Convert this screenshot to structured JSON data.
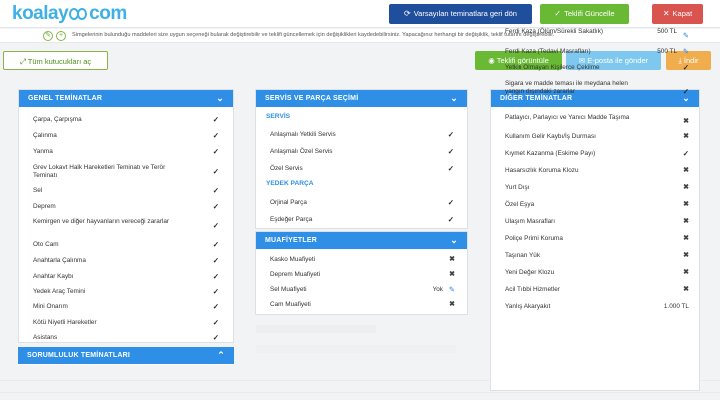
{
  "brand": {
    "logo_text_left": "koalay",
    "logo_text_right": "com"
  },
  "header": {
    "reset_label": "Varsayılan teminatlara geri dön",
    "update_label": "Teklifi Güncelle",
    "close_label": "Kapat"
  },
  "info": {
    "plus": "+",
    "text": "Simgelerinin bulunduğu maddeleri size uygun seçeneği bularak değiştirebilir ve teklifi güncellemek için değişiklikleri kaydedebilirsiniz. Yapacağınız herhangi bir değişiklik, teklif tutarını değiştirebilir."
  },
  "toolbar": {
    "toggle_label": "Tüm kutucukları aç",
    "show_label": "Teklifi görüntüle",
    "mail_label": "E-posta ile gönder",
    "download_label": "İndir"
  },
  "genel": {
    "title": "GENEL TEMİNATLAR",
    "items": [
      {
        "label": "Çarpa, Çarpışma"
      },
      {
        "label": "Çalınma"
      },
      {
        "label": "Yanma"
      },
      {
        "label": "Grev Lokavt Halk Hareketleri Teminatı ve Terör Teminatı"
      },
      {
        "label": "Sel"
      },
      {
        "label": "Deprem"
      },
      {
        "label": "Kemirgen ve diğer hayvanların vereceği zararlar"
      },
      {
        "label": "Oto Cam"
      },
      {
        "label": "Anahtarla Çalınma"
      },
      {
        "label": "Anahtar Kaybı"
      },
      {
        "label": "Yedek Araç Temini"
      },
      {
        "label": "Mini Onarım"
      },
      {
        "label": "Kötü Niyetli Hareketler"
      },
      {
        "label": "Asistans"
      }
    ]
  },
  "sorumluluk": {
    "title": "SORUMLULUK TEMİNATLARI"
  },
  "servis": {
    "title": "SERVİS VE PARÇA SEÇİMİ",
    "servis_heading": "SERVİS",
    "servis_items": [
      {
        "label": "Anlaşmalı Yetkili Servis"
      },
      {
        "label": "Anlaşmalı Özel Servis"
      },
      {
        "label": "Özel Servis"
      }
    ],
    "parca_heading": "YEDEK PARÇA",
    "parca_items": [
      {
        "label": "Orjinal Parça"
      },
      {
        "label": "Eşdeğer Parça"
      }
    ]
  },
  "muafiyet": {
    "title": "MUAFİYETLER",
    "items": [
      {
        "label": "Kasko Muafiyeti",
        "value": ""
      },
      {
        "label": "Deprem Muafiyeti",
        "value": ""
      },
      {
        "label": "Sel Muafiyeti",
        "value": "Yok"
      },
      {
        "label": "Cam Muafiyeti",
        "value": ""
      }
    ]
  },
  "diger": {
    "title": "DİĞER TEMİNATLAR",
    "items": [
      {
        "label": "Ferdi Kaza (Ölüm/Sürekli Sakatlık)",
        "value": "500 TL"
      },
      {
        "label": "Ferdi Kaza (Tedavi Masrafları)",
        "value": "500 TL"
      },
      {
        "label": "Yetkili Olmayan Kişilerce Çekilme",
        "value": ""
      },
      {
        "label": "Sigara ve madde teması ile meydana helen yangın dışındaki zararlar",
        "value": ""
      },
      {
        "label": "Patlayıcı, Parlayıcı ve Yanıcı Madde Taşıma",
        "value": ""
      },
      {
        "label": "Kullanım Gelir Kaybı/İş Durması",
        "value": ""
      },
      {
        "label": "Kıymet Kazanma (Eskime Payı)",
        "value": ""
      },
      {
        "label": "Hasarsızlık Koruma Klozu",
        "value": ""
      },
      {
        "label": "Yurt Dışı",
        "value": ""
      },
      {
        "label": "Özel Eşya",
        "value": ""
      },
      {
        "label": "Ulaşım Masrafları",
        "value": ""
      },
      {
        "label": "Poliçe Primi Koruma",
        "value": ""
      },
      {
        "label": "Taşınan Yük",
        "value": ""
      },
      {
        "label": "Yeni Değer Klozu",
        "value": ""
      },
      {
        "label": "Acil Tıbbi Hizmetler",
        "value": ""
      },
      {
        "label": "Yanlış Akaryakıt",
        "value": "1.000 TL"
      }
    ]
  },
  "icons": {
    "check": "check-icon",
    "cross": "cross-icon",
    "pen": "pencil-icon",
    "chevron_down": "chevron-down-icon",
    "chevron_up": "chevron-up-icon"
  },
  "colors": {
    "primary": "#2f8fe6",
    "green": "#69b935",
    "red": "#d9534f",
    "navy": "#1f4f9c",
    "orange": "#f0ad4e",
    "lightblue": "#7ec8ef"
  }
}
